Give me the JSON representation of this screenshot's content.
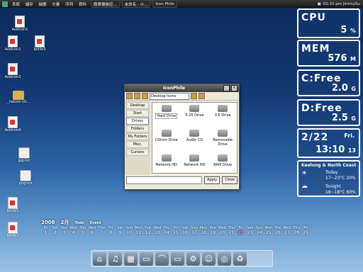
{
  "taskbar": {
    "menu": [
      "系統",
      "儲存",
      "繪圖",
      "文書",
      "序列",
      "資料"
    ],
    "tasks": [
      "簡單聲換控...",
      "未命名 - 小...",
      "Icon Phile"
    ],
    "clock": "01:10 pm JimmySu"
  },
  "desktop_icons": [
    {
      "label": "AveIcon1",
      "type": "file"
    },
    {
      "label": "AveIcon2",
      "type": "file"
    },
    {
      "label": "Iphile3",
      "type": "file"
    },
    {
      "label": "AveIcon3",
      "type": "file"
    },
    {
      "label": "_nature-10...",
      "type": "folder"
    },
    {
      "label": "AveIcon4",
      "type": "file"
    },
    {
      "label": "jpg-ico",
      "type": "face"
    },
    {
      "label": "png-ico",
      "type": "face"
    },
    {
      "label": "Iphile1",
      "type": "file"
    },
    {
      "label": "Iphile2",
      "type": "file"
    }
  ],
  "window": {
    "title": "IconPhile",
    "dropdown": "Desktop Icons",
    "sidebar": [
      "Desktop",
      "Start",
      "Drives",
      "Folders",
      "My Folders",
      "Misc.",
      "Cursors"
    ],
    "active_tab": "Drives",
    "items": [
      "Hard Drive",
      "5.25 Drive",
      "3.5 Drive",
      "CDrom Drive",
      "Audio CD",
      "Removable Drive",
      "Network HD",
      "Network HD",
      "RAM Drive"
    ],
    "buttons": {
      "apply": "Apply",
      "close": "Close"
    }
  },
  "widgets": {
    "cpu": {
      "title": "CPU",
      "value": "5",
      "unit": "%"
    },
    "mem": {
      "title": "MEM",
      "value": "576",
      "unit": "M"
    },
    "c_drive": {
      "title": "C:Free",
      "value": "2.0",
      "unit": "G"
    },
    "d_drive": {
      "title": "D:Free",
      "value": "2.5",
      "unit": "G"
    },
    "date": {
      "date": "2/22",
      "day": "Fri.",
      "time": "13:10",
      "seconds": "13"
    },
    "weather": {
      "location": "Keelung & North Coast",
      "today_label": "Today",
      "today_range": "17~23°C 20%",
      "tonight_label": "Tonight",
      "tonight_range": "16~18°C 60%"
    }
  },
  "calendar": {
    "year": "2008",
    "month": "2月",
    "todo": "Todo",
    "event": "Event",
    "weekdays": [
      "Fri",
      "Sat",
      "Sun",
      "Mon",
      "Tue",
      "Wed",
      "Thu",
      "Fri",
      "Sat",
      "Sun",
      "Mon",
      "Tue",
      "Wed",
      "Thu",
      "Fri",
      "Sat",
      "Sun",
      "Mon",
      "Tue",
      "Wed",
      "Thu",
      "Fri",
      "Sat",
      "Sun",
      "Mon",
      "Tue",
      "Wed",
      "Thu",
      "Fri"
    ],
    "days": [
      "1",
      "2",
      "3",
      "4",
      "5",
      "6",
      "7",
      "8",
      "9",
      "10",
      "11",
      "12",
      "13",
      "14",
      "15",
      "16",
      "17",
      "18",
      "19",
      "20",
      "21",
      "22",
      "23",
      "24",
      "25",
      "26",
      "27",
      "28",
      "29"
    ],
    "today": "22"
  },
  "dock": [
    "house-icon",
    "music-icon",
    "film-icon",
    "folder-icon",
    "hat-icon",
    "monitor-icon",
    "gear-icon",
    "people-icon",
    "globe-icon",
    "recycle-icon"
  ]
}
